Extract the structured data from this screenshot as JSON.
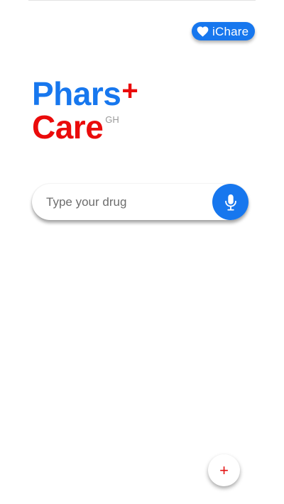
{
  "header": {
    "ichare_button": {
      "label": "iChare",
      "icon": "heart-icon"
    }
  },
  "logo": {
    "word1": "Phars",
    "plus": "+",
    "word2": "Care",
    "superscript": "GH"
  },
  "search": {
    "placeholder": "Type your drug",
    "value": "",
    "mic_icon": "microphone-icon"
  },
  "fab": {
    "label": "+",
    "icon": "plus-icon"
  },
  "colors": {
    "brand_blue": "#1777ee",
    "brand_red": "#ea0b0b",
    "background": "#ffffff"
  }
}
